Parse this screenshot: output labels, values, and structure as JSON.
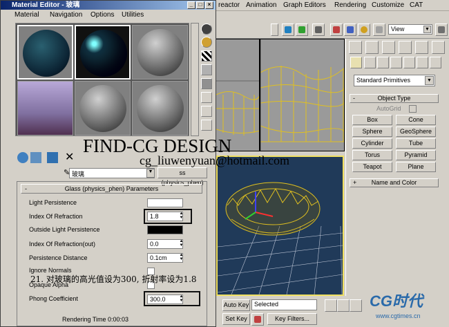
{
  "max": {
    "menu": [
      "reactor",
      "Animation",
      "Graph Editors",
      "Rendering",
      "Customize",
      "CAT"
    ],
    "view_select": "View",
    "command_panel": {
      "primitive_type": "Standard Primitives",
      "object_type_title": "Object Type",
      "autogrid": "AutoGrid",
      "buttons": [
        "Box",
        "Cone",
        "Sphere",
        "GeoSphere",
        "Cylinder",
        "Tube",
        "Torus",
        "Pyramid",
        "Teapot",
        "Plane"
      ],
      "name_color_title": "Name and Color"
    },
    "anim": {
      "auto_key": "Auto Key",
      "set_key": "Set Key",
      "selected": "Selected",
      "key_filters": "Key Filters..."
    },
    "logo": "CG时代",
    "logo_url": "www.cgtimes.cn"
  },
  "med": {
    "title": "Material Editor - 玻璃",
    "menu": [
      "Material",
      "Navigation",
      "Options",
      "Utilities"
    ],
    "material_name": "玻璃",
    "material_type": "ss (physics_phen)",
    "params": {
      "header": "Glass (physics_phen) Parameters",
      "light_persistence": "Light Persistence",
      "ior_label": "Index Of Refraction",
      "ior_value": "1.8",
      "outside_light": "Outside Light Persistence",
      "ior_out_label": "Index Of Refraction(out)",
      "ior_out_value": "0.0",
      "persist_dist_label": "Persistence Distance",
      "persist_dist_value": "0.1cm",
      "ignore_normals": "Ignore Normals",
      "opaque_alpha": "Opaque Alpha",
      "phong_label": "Phong Coefficient",
      "phong_value": "300.0"
    },
    "status_render": "Rendering Time  0:00:03"
  },
  "overlay": {
    "watermark_line1": "FIND-CG DESIGN",
    "watermark_line2": "cg_liuwenyuan@hotmail.com",
    "caption": "21. 对玻璃的高光值设为300, 折射率设为1.8"
  },
  "colors": {
    "viewport_bg": "#203a59",
    "wire": "#e0c020",
    "title_grad": "#0a246a"
  }
}
